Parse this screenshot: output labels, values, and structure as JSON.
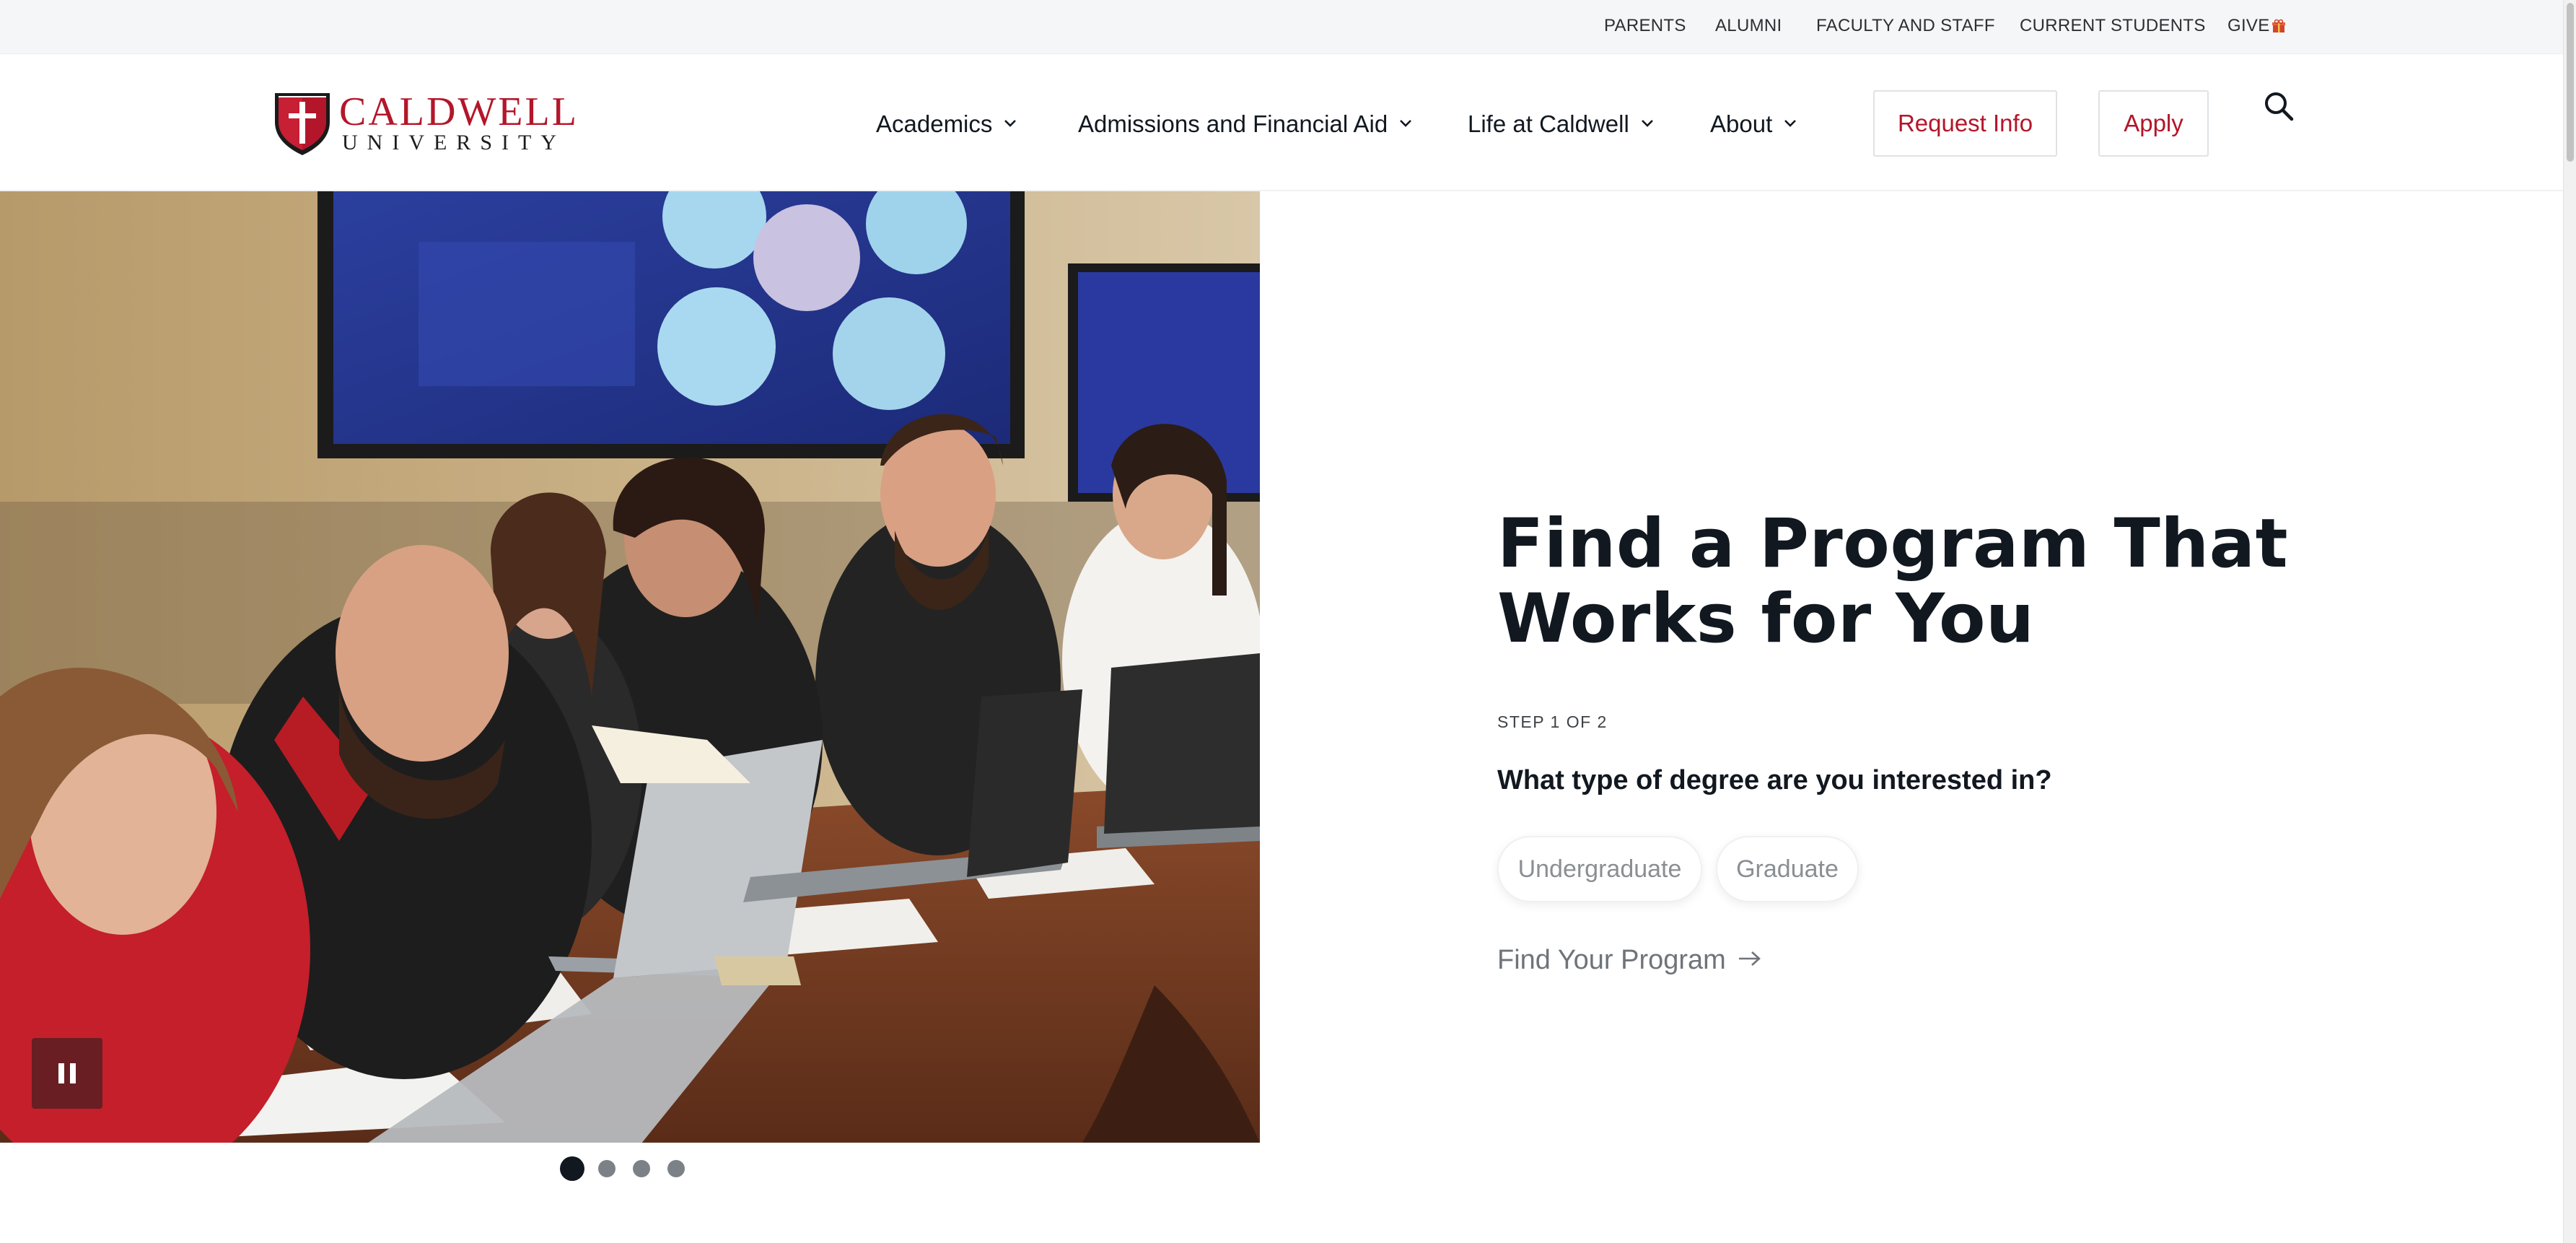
{
  "utility": {
    "links": [
      "PARENTS",
      "ALUMNI",
      "FACULTY AND STAFF",
      "CURRENT STUDENTS",
      "GIVE"
    ],
    "give_icon": "gift-icon"
  },
  "brand": {
    "name_main": "CALDWELL",
    "name_sub": "UNIVERSITY",
    "accent_color": "#b3162a"
  },
  "nav": {
    "items": [
      "Academics",
      "Admissions and Financial Aid",
      "Life at Caldwell",
      "About"
    ],
    "request_info": "Request Info",
    "apply": "Apply",
    "search_icon": "search-icon"
  },
  "hero": {
    "slides_total": 4,
    "active_slide": 1,
    "pause_icon": "pause-icon"
  },
  "finder": {
    "title": "Find a Program That Works for You",
    "step": "STEP 1 OF 2",
    "question": "What type of degree are you interested in?",
    "options": [
      "Undergraduate",
      "Graduate"
    ],
    "link": "Find Your Program",
    "link_icon": "arrow-right-icon"
  }
}
